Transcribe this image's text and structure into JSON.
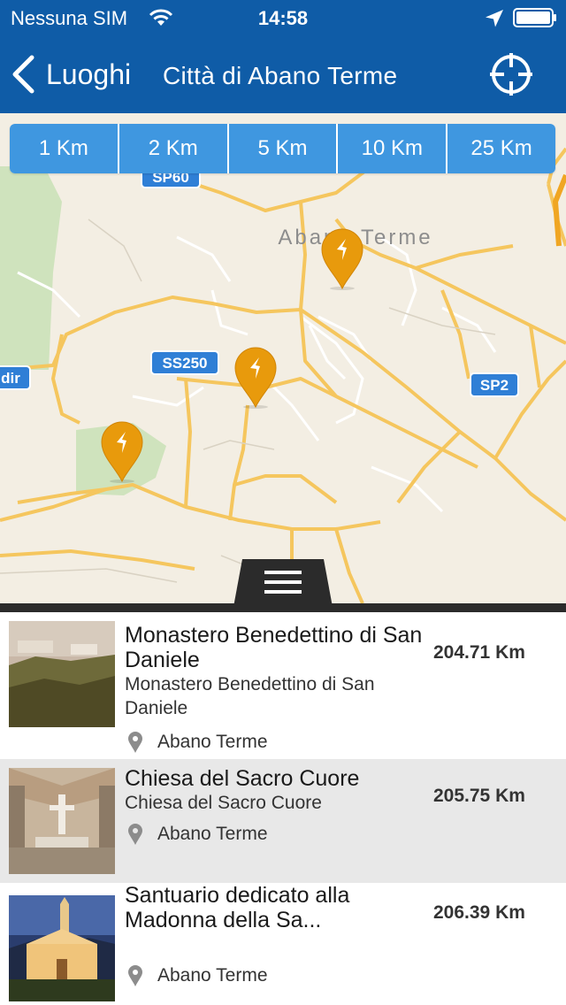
{
  "status_bar": {
    "carrier": "Nessuna SIM",
    "time": "14:58",
    "icons": [
      "wifi-icon",
      "location-arrow-icon",
      "battery-icon"
    ]
  },
  "nav": {
    "back_label": "Luoghi",
    "title": "Città di Abano Terme",
    "locate_icon": "crosshair-icon",
    "color": "#0f5ca7"
  },
  "map": {
    "ranges": [
      "1 Km",
      "2 Km",
      "5 Km",
      "10 Km",
      "25 Km"
    ],
    "town_label": "Abano Terme",
    "road_labels": {
      "sp60": "SP60",
      "ss250": "SS250",
      "sp2": "SP2",
      "dir": "dir"
    },
    "pin_color": "#e89a0c",
    "range_button_color": "#3f97e0",
    "drawer_icon": "hamburger-icon"
  },
  "places": [
    {
      "title": "Monastero Benedettino di San Daniele",
      "subtitle": "Monastero Benedettino di San Daniele",
      "location": "Abano Terme",
      "distance": "204.71 Km"
    },
    {
      "title": "Chiesa del Sacro Cuore",
      "subtitle": "Chiesa del Sacro Cuore",
      "location": "Abano Terme",
      "distance": "205.75 Km"
    },
    {
      "title": "Santuario dedicato alla Madonna della Sa...",
      "subtitle": "",
      "location": "Abano Terme",
      "distance": "206.39 Km"
    }
  ]
}
